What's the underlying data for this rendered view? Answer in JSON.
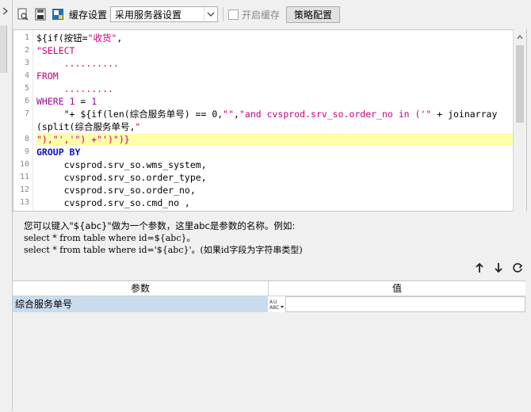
{
  "toolbar": {
    "cache_settings_label": "缓存设置",
    "cache_select_value": "采用服务器设置",
    "enable_cache_label": "开启缓存",
    "strategy_button": "策略配置",
    "icons": [
      "preview-icon",
      "save-icon",
      "cache-settings-icon"
    ]
  },
  "editor": {
    "lines": [
      {
        "n": "1",
        "parts": [
          [
            "t",
            "${if("
          ],
          [
            "t",
            "按钮"
          ],
          [
            "t",
            "="
          ],
          [
            "s",
            "\"收货\""
          ],
          [
            "t",
            ","
          ]
        ]
      },
      {
        "n": "2",
        "parts": [
          [
            "s",
            "\"SELECT"
          ]
        ]
      },
      {
        "n": "3",
        "parts": [
          [
            "s",
            "     .........."
          ]
        ]
      },
      {
        "n": "4",
        "parts": [
          [
            "s",
            "FROM"
          ]
        ]
      },
      {
        "n": "5",
        "parts": [
          [
            "s",
            "     ........."
          ]
        ]
      },
      {
        "n": "6",
        "parts": [
          [
            "k",
            "WHERE"
          ],
          [
            "t",
            " "
          ],
          [
            "k",
            "1"
          ],
          [
            "t",
            " = "
          ],
          [
            "k",
            "1"
          ]
        ]
      },
      {
        "n": "7",
        "parts": [
          [
            "t",
            "     \"+ ${if(len(综合服务单号) == 0,"
          ],
          [
            "s",
            "\"\""
          ],
          [
            "t",
            ","
          ],
          [
            "s",
            "\"and cvsprod.srv_so.order_no in ('\""
          ],
          [
            "t",
            " + joinarray"
          ]
        ]
      },
      {
        "n": "",
        "parts": [
          [
            "t",
            "(split(综合服务单号,"
          ],
          [
            "s",
            "\""
          ]
        ]
      },
      {
        "n": "8",
        "parts": [
          [
            "s",
            "\"),\"','\") +\"')\")}"
          ]
        ],
        "highlight": true
      },
      {
        "n": "9",
        "parts": [
          [
            "b",
            "GROUP BY"
          ]
        ]
      },
      {
        "n": "10",
        "parts": [
          [
            "t",
            "     cvsprod.srv_so.wms_system,"
          ]
        ]
      },
      {
        "n": "11",
        "parts": [
          [
            "t",
            "     cvsprod.srv_so.order_type,"
          ]
        ]
      },
      {
        "n": "12",
        "parts": [
          [
            "t",
            "     cvsprod.srv_so.order_no,"
          ]
        ]
      },
      {
        "n": "13",
        "parts": [
          [
            "t",
            "     cvsprod.srv_so.cmd_no ,"
          ]
        ]
      }
    ]
  },
  "hint": {
    "line1": "您可以键入\"${abc}\"做为一个参数，这里abc是参数的名称。例如:",
    "line2": "select * from table where id=${abc}。",
    "line3": "select * from table where id='${abc}'。(如果id字段为字符串类型)"
  },
  "params": {
    "col_param": "参数",
    "col_value": "值",
    "rows": [
      {
        "name": "综合服务单号",
        "value": ""
      }
    ]
  }
}
